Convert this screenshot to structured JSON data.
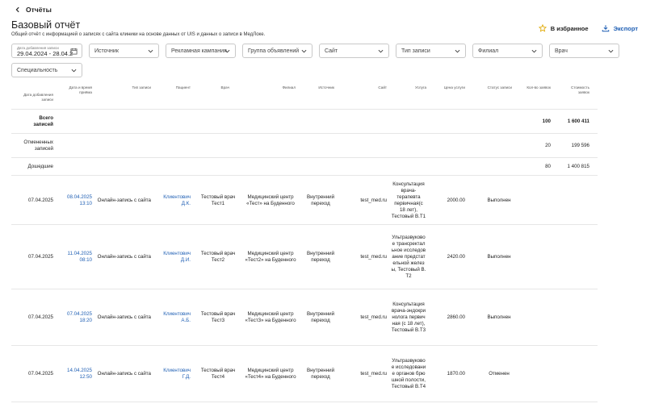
{
  "header": {
    "back_label": "Отчёты",
    "title": "Базовый отчёт",
    "subtitle": "Общий отчёт с информацией о записях с сайта клиники на основе данных от UIS и данных о записи в МедЛоке.",
    "favorite_label": "В избранное",
    "export_label": "Экспорт",
    "accent_color": "#1f5fb4"
  },
  "filters": {
    "date_label": "Дата добавления записи",
    "date_value": "29.04.2024 - 28.04.2",
    "source": "Источник",
    "ad_campaign": "Рекламная кампания",
    "ad_group": "Группа объявлений",
    "site": "Сайт",
    "record_type": "Тип записи",
    "branch": "Филиал",
    "doctor": "Врач",
    "specialty": "Специальность"
  },
  "table": {
    "columns": [
      "Дата добавления записи",
      "Дата и время приёма",
      "Тип записи",
      "Пациент",
      "Врач",
      "Филиал",
      "Источник",
      "Сайт",
      "Услуга",
      "Цена услуги",
      "Статус записи",
      "Кол-во заявок",
      "Стоимость заявок"
    ],
    "summary": [
      {
        "label": "Всего записей",
        "count": "100",
        "cost": "1 600 411"
      },
      {
        "label": "Отмененных записей",
        "count": "20",
        "cost": "199 596"
      },
      {
        "label": "Дошедшие",
        "count": "80",
        "cost": "1 400 815"
      }
    ],
    "rows": [
      {
        "added": "07.04.2025",
        "datetime": "08.04.2025 13:10",
        "type": "Онлайн-запись с сайта",
        "patient": "Клиентович Д.К.",
        "doctor": "Тестовый врач Тест1",
        "branch": "Медицинский центр «Тест» на Буденного",
        "source": "Внутренний переход",
        "site": "test_med.ru",
        "service": "Консультация врача-терапевта первичная(с 18 лет), Тестовый В.Т1",
        "price": "2000.00",
        "status": "Выполнен"
      },
      {
        "added": "07.04.2025",
        "datetime": "11.04.2025 08:10",
        "type": "Онлайн-запись с сайта",
        "patient": "Клиентович Д.И.",
        "doctor": "Тестовый врач Тест2",
        "branch": "Медицинский центр «Тест2» на Буденного",
        "source": "Внутренний переход",
        "site": "test_med.ru",
        "service": "Ультразвуковое трансректальное исследование предстательной железы, Тестовый В.Т2",
        "price": "2420.00",
        "status": "Выполнен"
      },
      {
        "added": "07.04.2025",
        "datetime": "07.04.2025 18:20",
        "type": "Онлайн-запись с сайта",
        "patient": "Клиентович А.Б.",
        "doctor": "Тестовый врач Тест3",
        "branch": "Медицинский центр «Тест3» на Буденного",
        "source": "Внутренний переход",
        "site": "test_med.ru",
        "service": "Консультация врача-эндокринолога первичная (с 18 лет), Тестовый В.Т3",
        "price": "2860.00",
        "status": "Выполнен"
      },
      {
        "added": "07.04.2025",
        "datetime": "14.04.2025 12:50",
        "type": "Онлайн-запись с сайта",
        "patient": "Клиентович Г.Д.",
        "doctor": "Тестовый врач Тест4",
        "branch": "Медицинский центр «Тест4» на Буденного",
        "source": "Внутренний переход",
        "site": "test_med.ru",
        "service": "Ультразвуковое исследование органов брюшной полости, Тестовый В.Т4",
        "price": "1870.00",
        "status": "Отменен"
      }
    ]
  }
}
